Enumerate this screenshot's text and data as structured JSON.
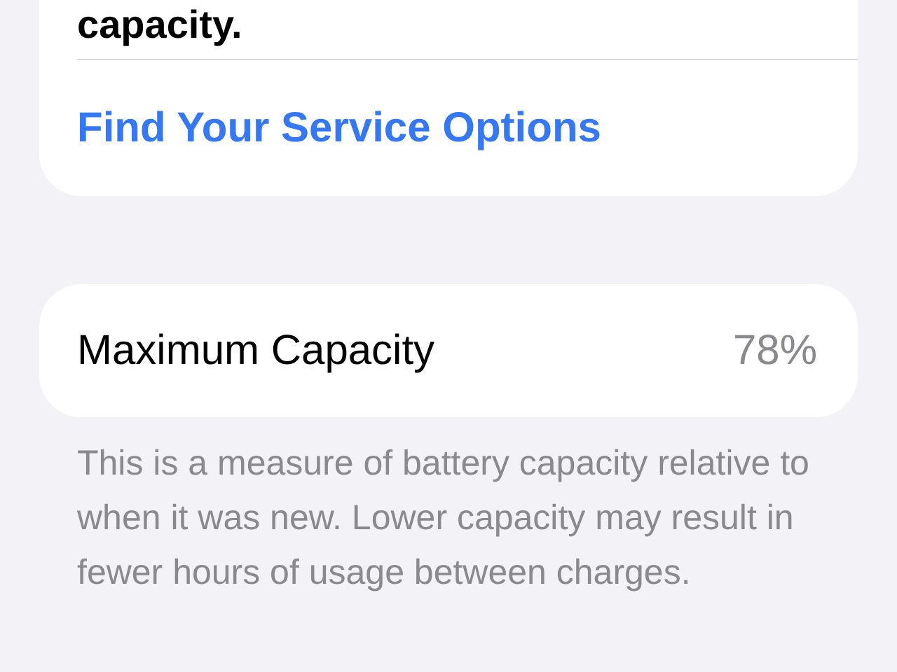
{
  "service_card": {
    "note_end": "capacity.",
    "link": "Find Your Service Options"
  },
  "capacity_card": {
    "label": "Maximum Capacity",
    "value": "78%"
  },
  "footnote": "This is a measure of battery capacity relative to when it was new. Lower capacity may result in fewer hours of usage between charges."
}
